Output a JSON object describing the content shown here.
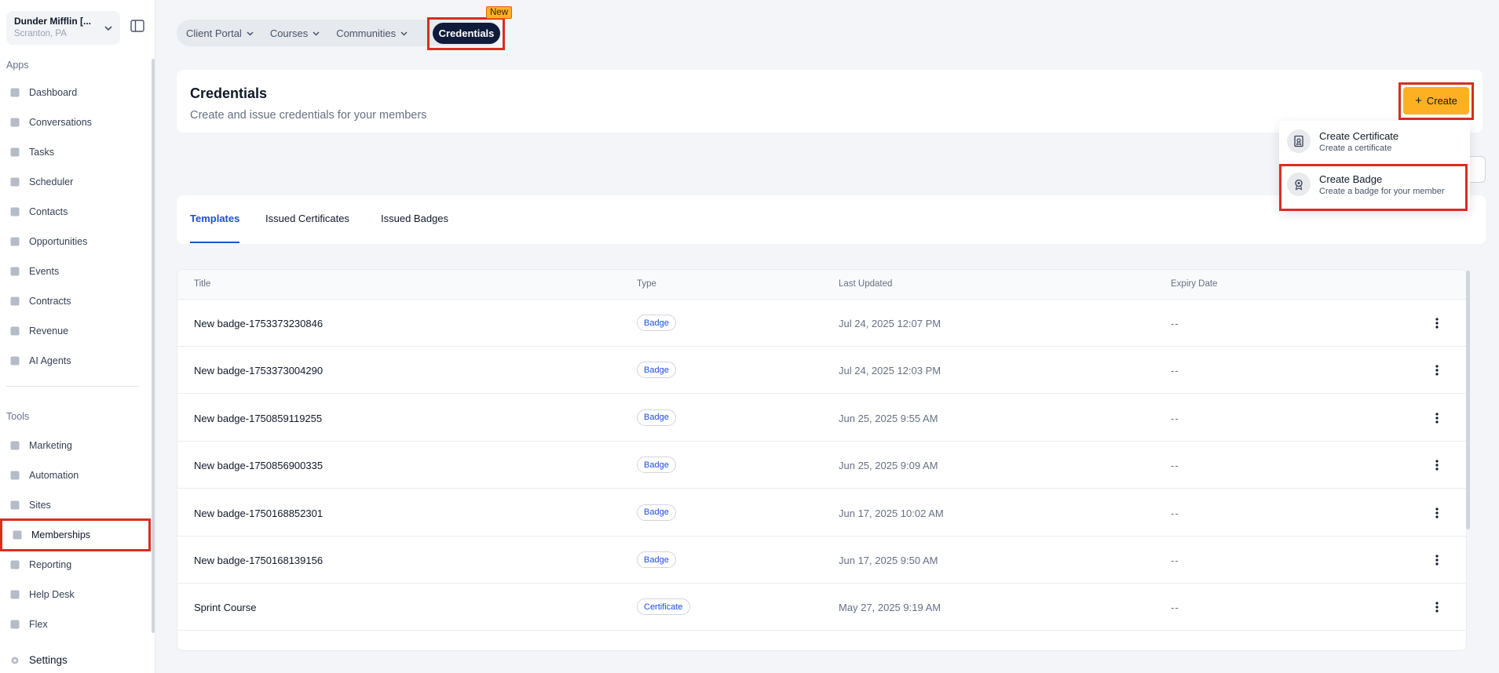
{
  "location": {
    "name": "Dunder Mifflin [...",
    "sub": "Scranton, PA"
  },
  "sidebar": {
    "apps_label": "Apps",
    "tools_label": "Tools",
    "apps": [
      {
        "label": "Dashboard",
        "icon": "dashboard-icon"
      },
      {
        "label": "Conversations",
        "icon": "chat-icon"
      },
      {
        "label": "Tasks",
        "icon": "tasks-icon"
      },
      {
        "label": "Scheduler",
        "icon": "calendar-icon"
      },
      {
        "label": "Contacts",
        "icon": "person-icon"
      },
      {
        "label": "Opportunities",
        "icon": "target-icon"
      },
      {
        "label": "Events",
        "icon": "event-icon"
      },
      {
        "label": "Contracts",
        "icon": "document-icon"
      },
      {
        "label": "Revenue",
        "icon": "card-icon"
      },
      {
        "label": "AI Agents",
        "icon": "sparkle-icon"
      }
    ],
    "tools": [
      {
        "label": "Marketing",
        "icon": "megaphone-icon"
      },
      {
        "label": "Automation",
        "icon": "gears-icon"
      },
      {
        "label": "Sites",
        "icon": "globe-icon"
      },
      {
        "label": "Memberships",
        "icon": "members-icon"
      },
      {
        "label": "Reporting",
        "icon": "pie-icon"
      },
      {
        "label": "Help Desk",
        "icon": "help-icon"
      },
      {
        "label": "Flex",
        "icon": "flex-icon"
      }
    ],
    "settings_label": "Settings"
  },
  "topnav": {
    "items": [
      "Client Portal",
      "Courses",
      "Communities"
    ],
    "active": "Credentials",
    "new_badge": "New"
  },
  "header": {
    "title": "Credentials",
    "subtitle": "Create and issue credentials for your members",
    "create_label": "Create"
  },
  "dropdown": {
    "items": [
      {
        "title": "Create Certificate",
        "sub": "Create a certificate",
        "icon": "certificate-icon"
      },
      {
        "title": "Create Badge",
        "sub": "Create a badge for your member",
        "icon": "badge-icon"
      }
    ]
  },
  "tabs": [
    "Templates",
    "Issued Certificates",
    "Issued Badges"
  ],
  "table": {
    "headers": [
      "Title",
      "Type",
      "Last Updated",
      "Expiry Date"
    ],
    "rows": [
      {
        "title": "New badge-1753373230846",
        "type": "Badge",
        "updated": "Jul 24, 2025 12:07 PM",
        "expiry": "--"
      },
      {
        "title": "New badge-1753373004290",
        "type": "Badge",
        "updated": "Jul 24, 2025 12:03 PM",
        "expiry": "--"
      },
      {
        "title": "New badge-1750859119255",
        "type": "Badge",
        "updated": "Jun 25, 2025 9:55 AM",
        "expiry": "--"
      },
      {
        "title": "New badge-1750856900335",
        "type": "Badge",
        "updated": "Jun 25, 2025 9:09 AM",
        "expiry": "--"
      },
      {
        "title": "New badge-1750168852301",
        "type": "Badge",
        "updated": "Jun 17, 2025 10:02 AM",
        "expiry": "--"
      },
      {
        "title": "New badge-1750168139156",
        "type": "Badge",
        "updated": "Jun 17, 2025 9:50 AM",
        "expiry": "--"
      },
      {
        "title": "Sprint Course",
        "type": "Certificate",
        "updated": "May 27, 2025 9:19 AM",
        "expiry": "--"
      }
    ]
  },
  "colors": {
    "accent": "#fdb022",
    "highlight": "#d92d20",
    "link": "#1d4ed8",
    "active_nav": "#101a3a"
  }
}
